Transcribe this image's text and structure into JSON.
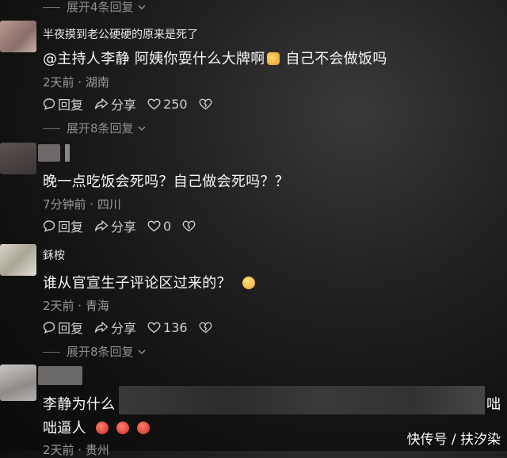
{
  "comments": [
    {
      "expand_above": "展开4条回复",
      "username": "半夜摸到老公硬硬的原来是死了",
      "text": "@主持人李静  阿姨你耍什么大牌啊",
      "text_after_emoji": " 自己不会做饭吗",
      "meta": "2天前 · 湖南",
      "reply_label": "回复",
      "share_label": "分享",
      "likes": "250",
      "expand_replies": "展开8条回复"
    },
    {
      "username": "",
      "text": "晚一点吃饭会死吗？自己做会死吗？？",
      "meta": "7分钟前 · 四川",
      "reply_label": "回复",
      "share_label": "分享",
      "likes": "0"
    },
    {
      "username": "鉌桉",
      "text": "谁从官宣生子评论区过来的？",
      "meta": "2天前 · 青海",
      "reply_label": "回复",
      "share_label": "分享",
      "likes": "136",
      "expand_replies": "展开8条回复"
    },
    {
      "username": "",
      "text_line1_start": "李静为什么",
      "text_line1_end": "咄",
      "text_line2": "咄逼人",
      "meta": "2天前 · 贵州"
    }
  ],
  "icons": {
    "reply": "reply-bubble-icon",
    "share": "share-arrow-icon",
    "like": "heart-icon",
    "dislike": "broken-heart-icon"
  },
  "watermark": "快传号 / 扶汐染",
  "colors": {
    "text": "#f7f7f7",
    "meta": "#9a9a9a",
    "background": "#121111"
  }
}
